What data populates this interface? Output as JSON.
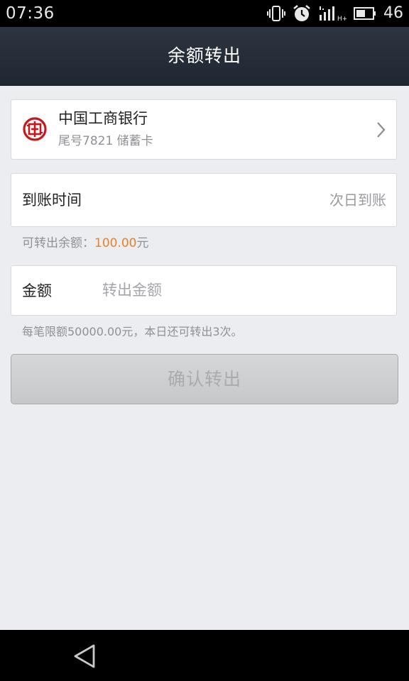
{
  "status_bar": {
    "time": "07:36",
    "battery_level": "46",
    "icons": [
      "vibrate-icon",
      "alarm-icon",
      "signal-icon",
      "battery-icon"
    ]
  },
  "header": {
    "title": "余额转出"
  },
  "bank_card": {
    "name": "中国工商银行",
    "detail": "尾号7821 储蓄卡",
    "logo_icon": "icbc-logo-icon",
    "logo_color": "#c8161d"
  },
  "arrival": {
    "label": "到账时间",
    "value": "次日到账"
  },
  "balance": {
    "label": "可转出余额：",
    "amount": "100.00",
    "unit": "元",
    "amount_color": "#e3812d"
  },
  "amount_field": {
    "label": "金额",
    "placeholder": "转出金额",
    "value": ""
  },
  "limit_note": "每笔限额50000.00元，本日还可转出3次。",
  "confirm_button": {
    "label": "确认转出"
  }
}
